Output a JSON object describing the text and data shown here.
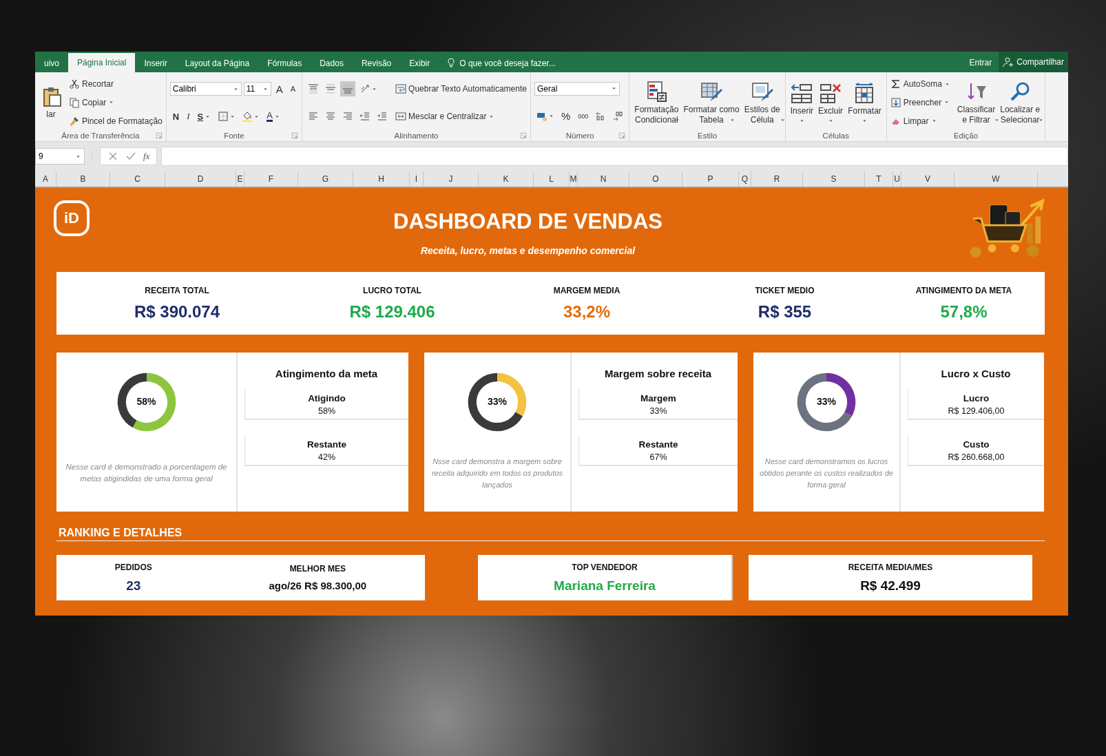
{
  "menu": {
    "tabs": [
      {
        "label": "uivo",
        "selected": false
      },
      {
        "label": "Página Inicial",
        "selected": true
      },
      {
        "label": "Inserir",
        "selected": false
      },
      {
        "label": "Layout da Página",
        "selected": false
      },
      {
        "label": "Fórmulas",
        "selected": false
      },
      {
        "label": "Dados",
        "selected": false
      },
      {
        "label": "Revisão",
        "selected": false
      },
      {
        "label": "Exibir",
        "selected": false
      }
    ],
    "tell_me": "O que você deseja fazer...",
    "sign_in": "Entrar",
    "share": "Compartilhar"
  },
  "ribbon": {
    "groups": [
      {
        "label": "Área de Transferência",
        "launcher": true,
        "columns": [
          [
            [
              {
                "kind": "clipboard",
                "lines": [
                  "lar"
                ]
              }
            ]
          ],
          [
            [
              {
                "kind": "scissors",
                "label": "Recortar"
              }
            ],
            [
              {
                "kind": "documents",
                "label": "Copiar",
                "menu": true
              }
            ],
            [
              {
                "kind": "brush",
                "label": "Pincel de Formatação"
              }
            ]
          ]
        ]
      },
      {
        "label": "Fonte",
        "launcher": true,
        "columns": [
          [
            [
              {
                "kind": "fontname",
                "value": "Calibri"
              },
              {
                "kind": "fontsize",
                "value": "11"
              },
              {
                "kind": "grow",
                "text": "A"
              },
              {
                "kind": "shrink",
                "text": "A"
              }
            ],
            [
              {
                "kind": "bold",
                "text": "N"
              },
              {
                "kind": "italic",
                "text": "I"
              },
              {
                "kind": "underline",
                "text": "S",
                "menu": true
              },
              {
                "kind": "borders",
                "menu": true
              },
              {
                "kind": "bucket",
                "menu": true
              },
              {
                "kind": "fontcolor",
                "text": "A",
                "menu": true
              }
            ]
          ]
        ]
      },
      {
        "label": "Alinhamento",
        "launcher": true,
        "columns": [
          [
            [
              {
                "kind": "altop",
                "on": false
              },
              {
                "kind": "almid",
                "on": false
              },
              {
                "kind": "albot",
                "on": true
              },
              {
                "kind": "orientation",
                "on": false,
                "menu": true
              }
            ],
            [
              {
                "kind": "alleft",
                "on": false
              },
              {
                "kind": "alcenter",
                "on": false
              },
              {
                "kind": "alright",
                "on": false
              },
              {
                "kind": "outdent",
                "on": false
              },
              {
                "kind": "indent",
                "on": false
              }
            ]
          ],
          [
            [
              {
                "kind": "wrap",
                "label": "Quebrar Texto Automaticamente"
              }
            ],
            [
              {
                "kind": "merge",
                "label": "Mesclar e Centralizar",
                "menu": true
              }
            ]
          ]
        ]
      },
      {
        "label": "Número",
        "launcher": true,
        "columns": [
          [
            [
              {
                "kind": "numberformat",
                "value": "Geral"
              }
            ],
            [
              {
                "kind": "money",
                "menu": true
              },
              {
                "kind": "percent",
                "text": "%"
              },
              {
                "kind": "thousands",
                "text": "000"
              },
              {
                "kind": "decinc"
              },
              {
                "kind": "decdec"
              }
            ]
          ]
        ]
      },
      {
        "label": "Estilo",
        "launcher": false,
        "columns": [
          [
            [
              {
                "kind": "condfmt",
                "lines": [
                  "Formatação",
                  "Condicional"
                ],
                "menu": true
              },
              {
                "kind": "tablefmt",
                "lines": [
                  "Formatar como",
                  "Tabela"
                ],
                "menu": true
              },
              {
                "kind": "cellstyles",
                "lines": [
                  "Estilos de",
                  "Célula"
                ],
                "menu": true
              }
            ]
          ]
        ]
      },
      {
        "label": "Células",
        "launcher": false,
        "columns": [
          [
            [
              {
                "kind": "insert",
                "lines": [
                  "Inserir"
                ],
                "menu": true
              },
              {
                "kind": "delete",
                "lines": [
                  "Excluir"
                ],
                "menu": true
              },
              {
                "kind": "format",
                "lines": [
                  "Formatar"
                ],
                "menu": true
              }
            ]
          ]
        ]
      },
      {
        "label": "Edição",
        "launcher": false,
        "columns": [
          [
            [
              {
                "kind": "sigma",
                "label": "AutoSoma",
                "menu": true
              }
            ],
            [
              {
                "kind": "filldown",
                "label": "Preencher",
                "menu": true
              }
            ],
            [
              {
                "kind": "eraser",
                "label": "Limpar",
                "menu": true
              }
            ]
          ],
          [
            [
              {
                "kind": "sortfilter",
                "lines": [
                  "Classificar",
                  "e Filtrar"
                ],
                "menu": true
              },
              {
                "kind": "magnifier",
                "lines": [
                  "Localizar e",
                  "Selecionar"
                ],
                "menu": true
              }
            ]
          ]
        ]
      }
    ]
  },
  "formula_bar": {
    "name_box": "9",
    "function_label": "fx"
  },
  "columns": [
    "A",
    "B",
    "C",
    "D",
    "E",
    "F",
    "G",
    "H",
    "I",
    "J",
    "K",
    "L",
    "M",
    "N",
    "O",
    "P",
    "Q",
    "R",
    "S",
    "T",
    "U",
    "V",
    "W"
  ],
  "dashboard": {
    "logo": "iD",
    "title": "DASHBOARD DE VENDAS",
    "subtitle": "Receita, lucro, metas e desempenho comercial",
    "kpis": [
      {
        "label": "RECEITA TOTAL",
        "value": "R$ 390.074",
        "color": "#1f2d6b"
      },
      {
        "label": "LUCRO TOTAL",
        "value": "R$ 129.406",
        "color": "#1faa4a"
      },
      {
        "label": "MARGEM MEDIA",
        "value": "33,2%",
        "color": "#e36c0a"
      },
      {
        "label": "TICKET MEDIO",
        "value": "R$ 355",
        "color": "#1f2d6b"
      },
      {
        "label": "ATINGIMENTO DA META",
        "value": "57,8%",
        "color": "#1faa4a"
      }
    ],
    "cards": [
      {
        "center_label": "58%",
        "color": "#8cc63f",
        "chart_data": {
          "type": "donut",
          "categories": [
            "Atigindo",
            "Restante"
          ],
          "values": [
            58,
            42
          ]
        },
        "description": "Nesse card é demonstrado a porcentagem de metas atigindidas de uma forma geral",
        "title": "Atingimento da meta",
        "stat_values": [
          "58%",
          "42%"
        ]
      },
      {
        "center_label": "33%",
        "color": "#f4c242",
        "chart_data": {
          "type": "donut",
          "categories": [
            "Margem",
            "Restante"
          ],
          "values": [
            33,
            67
          ]
        },
        "description": "Nsse card demonstra a margem sobre receita adquirido em todos os produtos lançados",
        "title": "Margem sobre receita",
        "stat_values": [
          "33%",
          "67%"
        ]
      },
      {
        "center_label": "33%",
        "color": "#7030a0",
        "chart_data": {
          "type": "donut",
          "categories": [
            "Lucro",
            "Custo"
          ],
          "values": [
            33,
            67
          ]
        },
        "description": "Nesse card demonstramos os lucros obtidos perante os custos realizados de forma geral",
        "title": "Lucro x Custo",
        "stat_values": [
          "R$ 129.406,00",
          "R$ 260.668,00"
        ]
      }
    ],
    "section_title": "RANKING E DETALHES",
    "details": [
      {
        "fields": [
          {
            "label": "PEDIDOS",
            "value": "23",
            "color": "#1f2d6b"
          },
          {
            "label": "MELHOR MES",
            "value": "ago/26 R$ 98.300,00",
            "color": "#111111"
          }
        ]
      },
      {
        "fields": [
          {
            "label": "TOP VENDEDOR",
            "value": "Mariana Ferreira",
            "color": "#1faa4a"
          }
        ]
      },
      {
        "fields": [
          {
            "label": "RECEITA MEDIA/MES",
            "value": "R$ 42.499",
            "color": "#111111"
          }
        ]
      }
    ]
  }
}
